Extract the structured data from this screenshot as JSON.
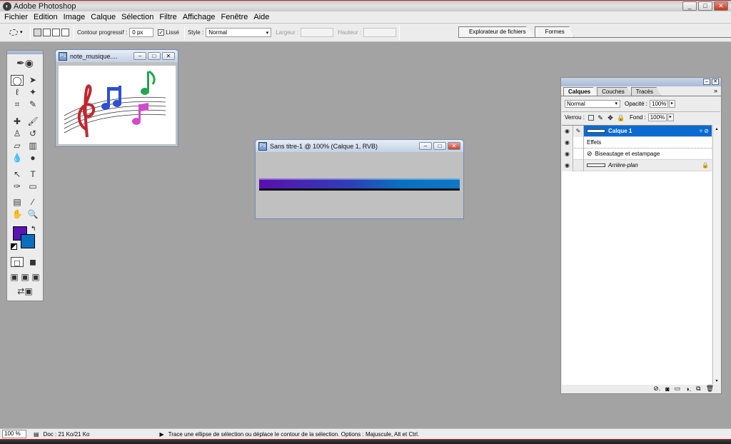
{
  "app": {
    "title": "Adobe Photoshop"
  },
  "menu": [
    "Fichier",
    "Edition",
    "Image",
    "Calque",
    "Sélection",
    "Filtre",
    "Affichage",
    "Fenêtre",
    "Aide"
  ],
  "options": {
    "feather_label": "Contour progressif :",
    "feather_value": "0 px",
    "antialias_label": "Lissé",
    "antialias_checked": "✓",
    "style_label": "Style :",
    "style_value": "Normal",
    "width_label": "Largeur :",
    "height_label": "Hauteur :"
  },
  "palette_well": {
    "tabs": [
      "Explorateur de fichiers",
      "Formes"
    ]
  },
  "docs": {
    "music": {
      "title": "note_musique...."
    },
    "main": {
      "title": "Sans titre-1 @ 100% (Calque 1, RVB)"
    }
  },
  "colors": {
    "foreground": "#5a15b1",
    "background": "#0a6fbf",
    "stripe_start": "#5a0fb0",
    "stripe_end": "#0d78c6",
    "selection": "#0a6ad0"
  },
  "layers_panel": {
    "tabs": [
      "Calques",
      "Couches",
      "Tracés"
    ],
    "blend_mode": "Normal",
    "opacity_label": "Opacité :",
    "opacity_value": "100%",
    "lock_label": "Verrou :",
    "fill_label": "Fond :",
    "fill_value": "100%",
    "layers": {
      "layer1": "Calque 1",
      "effects": "Effets",
      "bevel": "Biseautage et estampage",
      "background": "Arrière-plan"
    }
  },
  "status": {
    "zoom": "100 %",
    "doc": "Doc : 21 Ko/21 Ko",
    "hint": "Trace une ellipse de sélection ou déplace le contour de la sélection. Options : Majuscule, Alt et Ctrl."
  }
}
